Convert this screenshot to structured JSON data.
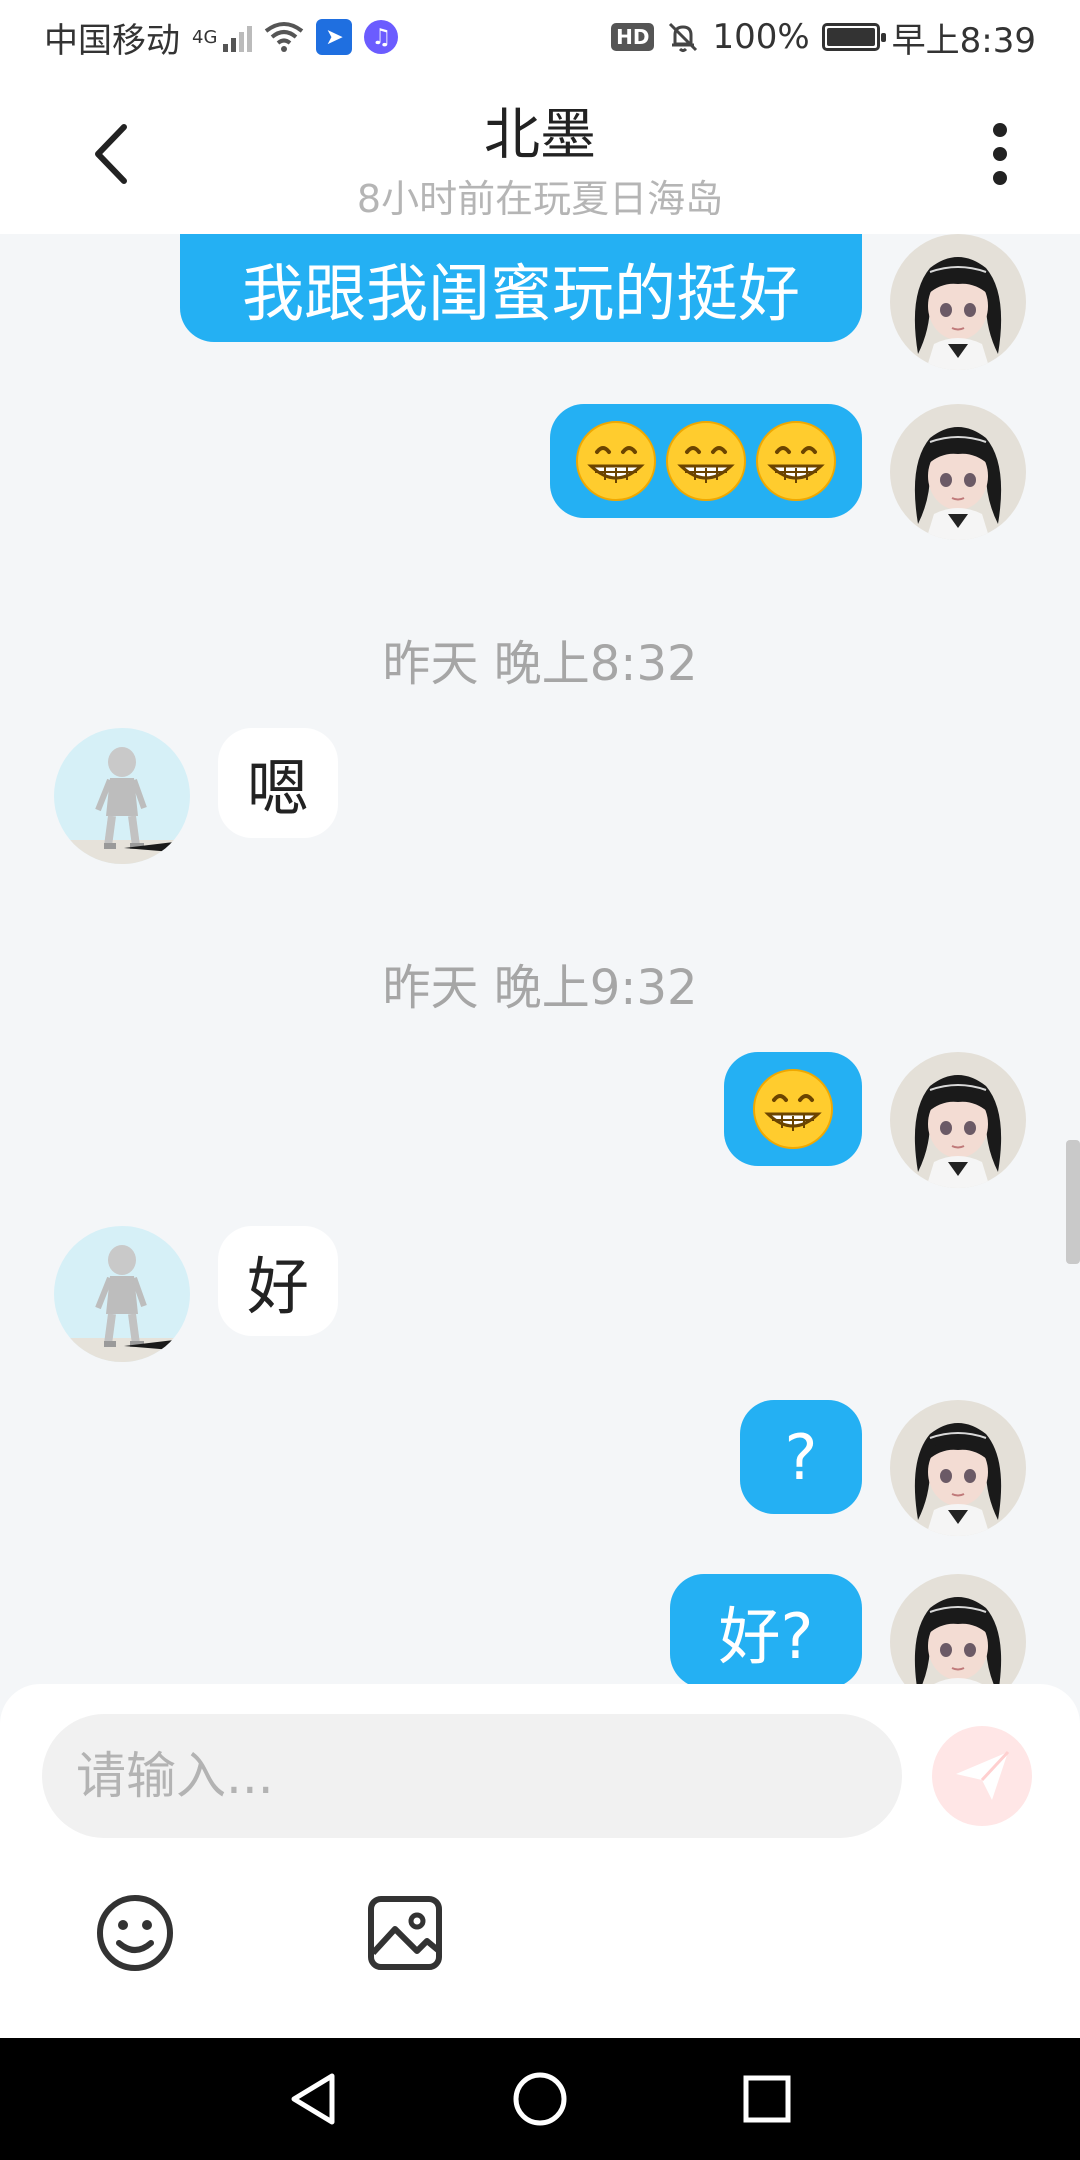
{
  "status_bar": {
    "carrier": "中国移动",
    "network": "4G",
    "hd": "HD",
    "battery": "100%",
    "battery_level": 1.0,
    "time": "早上8:39"
  },
  "header": {
    "title": "北墨",
    "subtitle": "8小时前在玩夏日海岛"
  },
  "messages": [
    {
      "side": "out",
      "text": "我跟我闺蜜玩的挺好"
    },
    {
      "side": "out",
      "emoji": "grinning-face-with-smiling-eyes",
      "count": 3
    },
    {
      "type": "timestamp",
      "text": "昨天 晚上8:32"
    },
    {
      "side": "in",
      "text": "嗯"
    },
    {
      "type": "timestamp",
      "text": "昨天 晚上9:32"
    },
    {
      "side": "out",
      "emoji": "grinning-face-with-smiling-eyes",
      "count": 1
    },
    {
      "side": "in",
      "text": "好"
    },
    {
      "side": "out",
      "text": "?"
    },
    {
      "side": "out",
      "text": "好?"
    }
  ],
  "input": {
    "placeholder": "请输入..."
  },
  "icons": {
    "back": "chevron-left-icon",
    "more": "more-vertical-icon",
    "send": "paper-plane-icon",
    "emoji": "smiley-icon",
    "image": "image-icon"
  },
  "colors": {
    "outgoing_bubble": "#24b0f3",
    "incoming_bubble": "#ffffff",
    "background": "#f4f6f8",
    "send_button": "#ffe6e6"
  }
}
